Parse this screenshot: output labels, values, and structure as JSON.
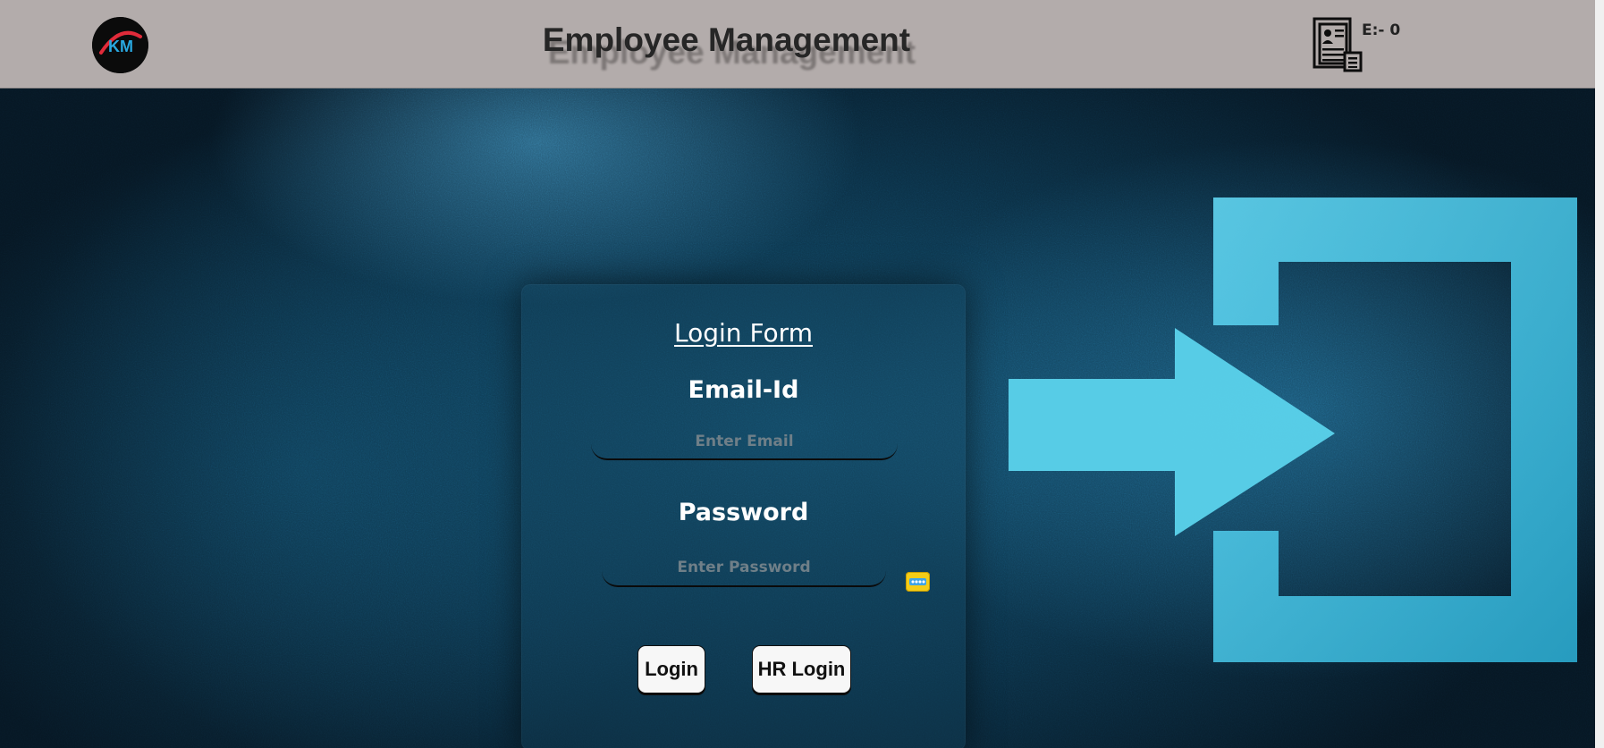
{
  "header": {
    "title": "Employee Management",
    "employee_count": "E:- 0",
    "logo_text": "KM"
  },
  "login_form": {
    "title": "Login Form",
    "email_label": "Email-Id",
    "email_placeholder": "Enter Email",
    "email_value": "",
    "password_label": "Password",
    "password_placeholder": "Enter Password",
    "password_value": "",
    "login_button": "Login",
    "hr_login_button": "HR Login"
  },
  "icons": {
    "logo": "km-logo-icon",
    "header_right": "document-list-icon",
    "password_toggle": "password-dots-icon",
    "hero": "login-arrow-icon"
  },
  "colors": {
    "header_bg": "#b3acab",
    "title_text": "#262626",
    "hero_accent": "#4fc3e0",
    "hero_dark": "#0b2f44",
    "button_bg": "#f7f7f7",
    "password_toggle": "#f5cd17"
  }
}
